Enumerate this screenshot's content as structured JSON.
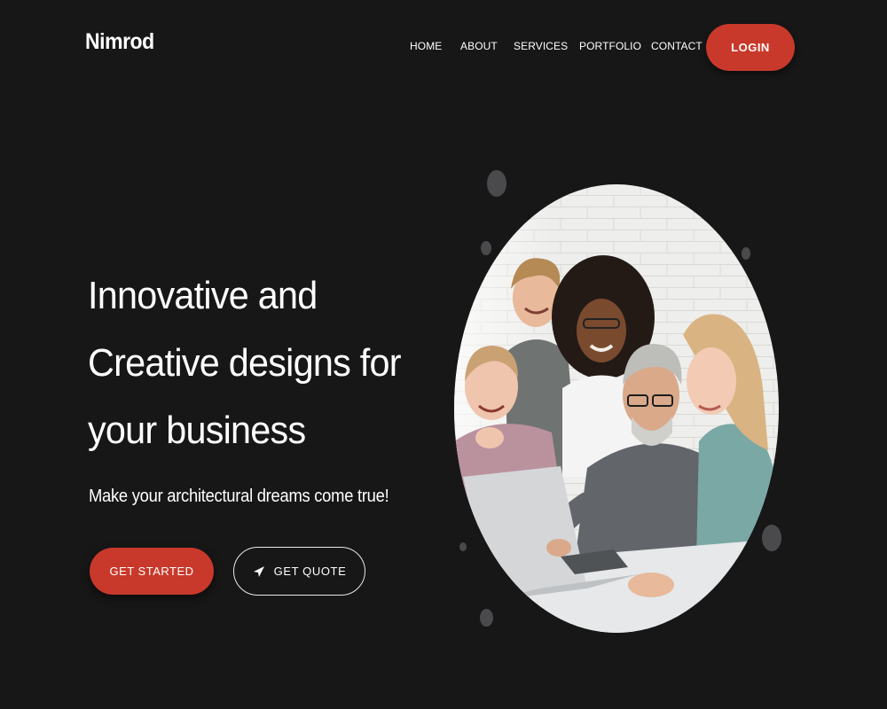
{
  "brand": {
    "name": "Nimrod"
  },
  "nav": {
    "items": [
      {
        "label": "HOME"
      },
      {
        "label": "ABOUT"
      },
      {
        "label": "SERVICES"
      },
      {
        "label": "PORTFOLIO"
      },
      {
        "label": "CONTACT"
      }
    ],
    "login_label": "LOGIN"
  },
  "hero": {
    "headline": "Innovative and Creative designs for your business",
    "subtitle": "Make your architectural dreams come true!",
    "primary_cta": "GET STARTED",
    "secondary_cta": "GET QUOTE",
    "secondary_cta_icon": "paper-plane-icon",
    "image": "team-meeting-photo"
  },
  "colors": {
    "background": "#181718",
    "accent": "#c8392b",
    "text": "#ffffff",
    "decor_dot": "#4a4a4c"
  }
}
